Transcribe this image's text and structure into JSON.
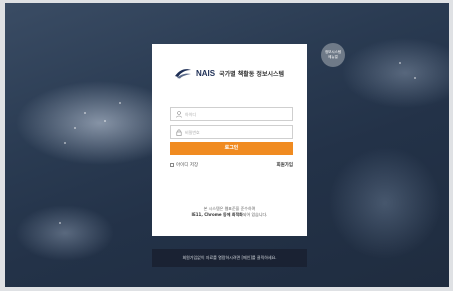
{
  "logo": {
    "brand": "NAIS",
    "subtitle": "국가별 책활동 정보시스템"
  },
  "login_form": {
    "id_placeholder": "아이디",
    "pw_placeholder": "비밀번호",
    "login_button": "로그인",
    "remember_label": "아이디 저장",
    "signup_link": "회원가입"
  },
  "notice": {
    "line1": "본 시스템은 웹표준을 준수하며",
    "line2_bold": "IE11, Chrome 등에 최적화",
    "line2_rest": "되어 있습니다."
  },
  "help_badge": {
    "line1": "정보시스템",
    "line2": "메뉴얼"
  },
  "bottom_banner": {
    "text": "회원가입없이 자료를 열람하시려면 [메인]를 클릭하세요."
  },
  "colors": {
    "accent": "#f08b21",
    "brand": "#1d2e55",
    "banner_bg": "#1a2233"
  }
}
